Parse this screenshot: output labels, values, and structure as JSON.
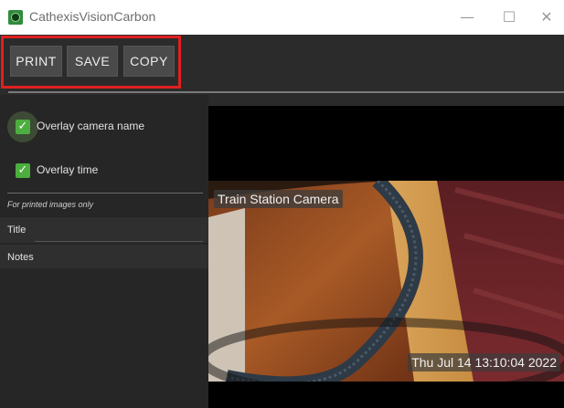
{
  "window": {
    "title": "CathexisVisionCarbon",
    "minimize_glyph": "—",
    "maximize_glyph": "☐",
    "close_glyph": "✕"
  },
  "toolbar": {
    "print_label": "PRINT",
    "save_label": "SAVE",
    "copy_label": "COPY",
    "highlight_color": "#e02020"
  },
  "options": {
    "overlay_camera_name": {
      "label": "Overlay camera name",
      "checked": true
    },
    "overlay_time": {
      "label": "Overlay time",
      "checked": true
    },
    "printed_note": "For printed images only",
    "title_label": "Title",
    "title_value": "",
    "notes_label": "Notes",
    "notes_value": ""
  },
  "camera": {
    "name_overlay": "Train Station Camera",
    "time_overlay": "Thu Jul 14 13:10:04 2022"
  },
  "colors": {
    "accent_green": "#4cae3e",
    "panel_bg": "#262626"
  }
}
